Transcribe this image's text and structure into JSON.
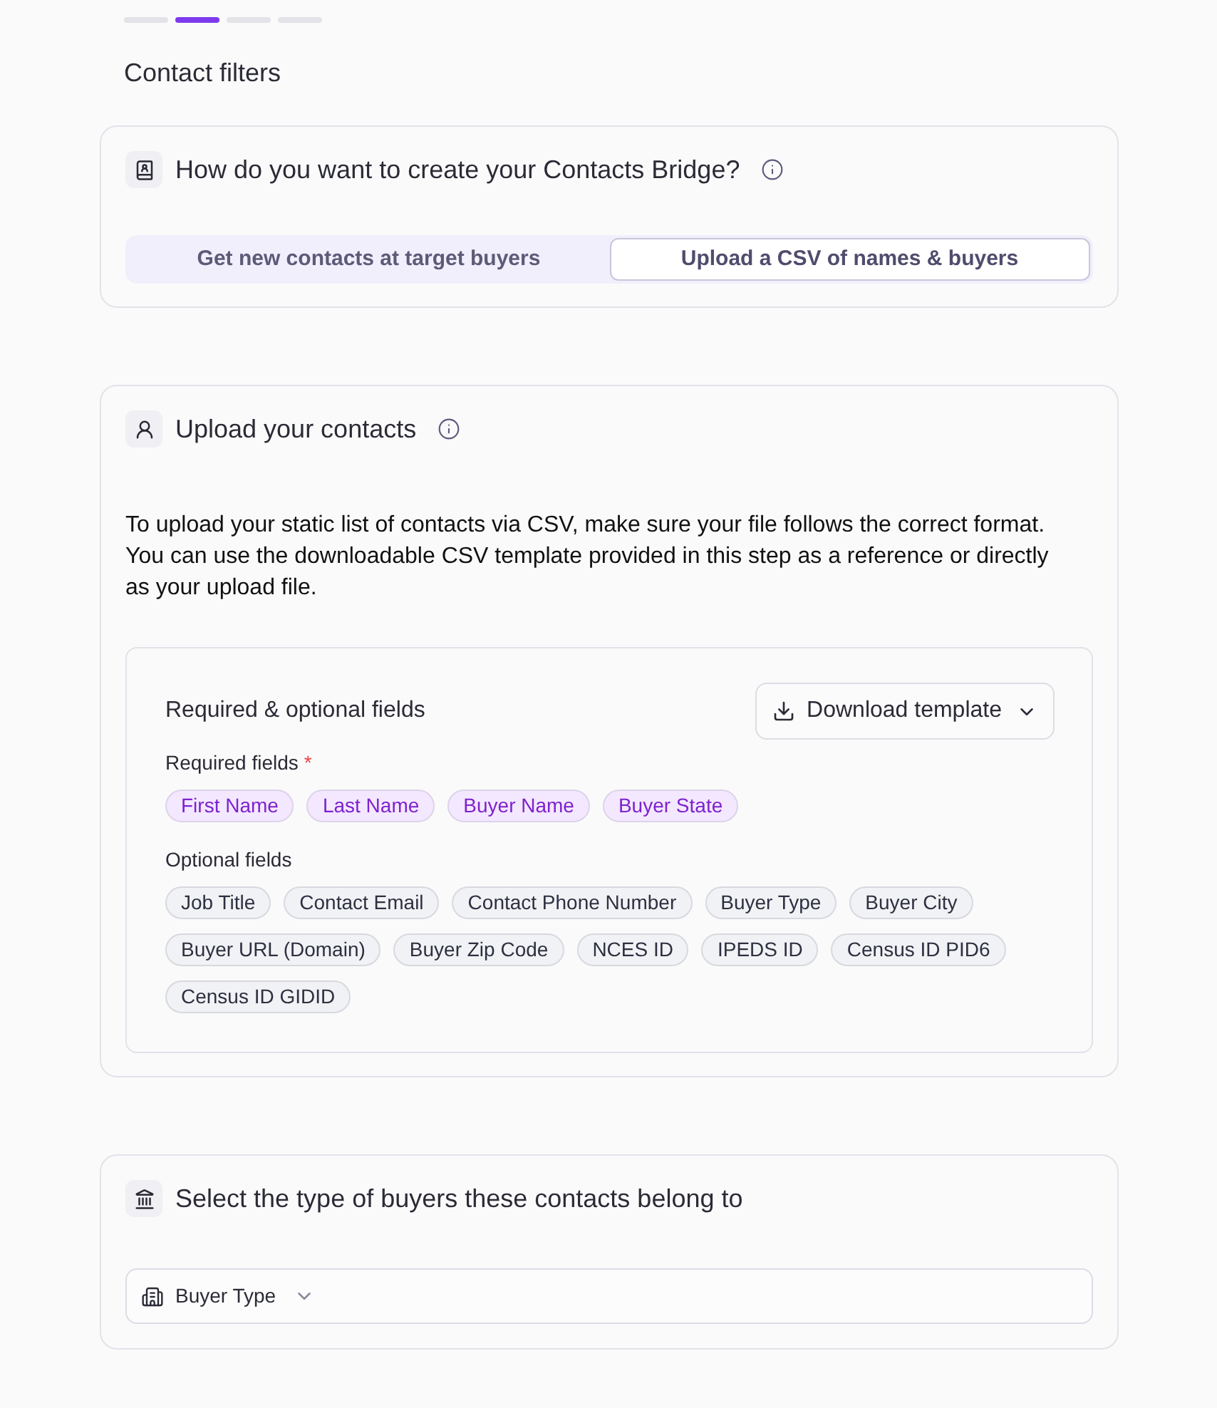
{
  "progress_steps": [
    {
      "selected": false
    },
    {
      "selected": true
    },
    {
      "selected": false
    },
    {
      "selected": false
    }
  ],
  "page_title": "Contact filters",
  "creation_method": {
    "title": "How do you want to create your Contacts Bridge?",
    "options": [
      {
        "label": "Get new contacts at target buyers",
        "selected": false
      },
      {
        "label": "Upload a CSV of names & buyers",
        "selected": true
      }
    ]
  },
  "upload_contacts": {
    "title": "Upload your contacts",
    "description": "To upload your static list of contacts via CSV, make sure your file follows the correct format. You can use the downloadable CSV template provided in this step as a reference or directly as your upload file.",
    "fields_panel": {
      "title": "Required & optional fields",
      "download_button": "Download template",
      "required": {
        "label": "Required fields",
        "required_mark": "*",
        "chips": [
          "First Name",
          "Last Name",
          "Buyer Name",
          "Buyer State"
        ]
      },
      "optional": {
        "label": "Optional fields",
        "chips": [
          "Job Title",
          "Contact Email",
          "Contact Phone Number",
          "Buyer Type",
          "Buyer City",
          "Buyer URL (Domain)",
          "Buyer Zip Code",
          "NCES ID",
          "IPEDS ID",
          "Census ID PID6",
          "Census ID GIDID"
        ]
      }
    }
  },
  "buyer_type_section": {
    "title": "Select the type of buyers these contacts belong to",
    "buyer_type_select": {
      "label": "Buyer Type"
    }
  }
}
